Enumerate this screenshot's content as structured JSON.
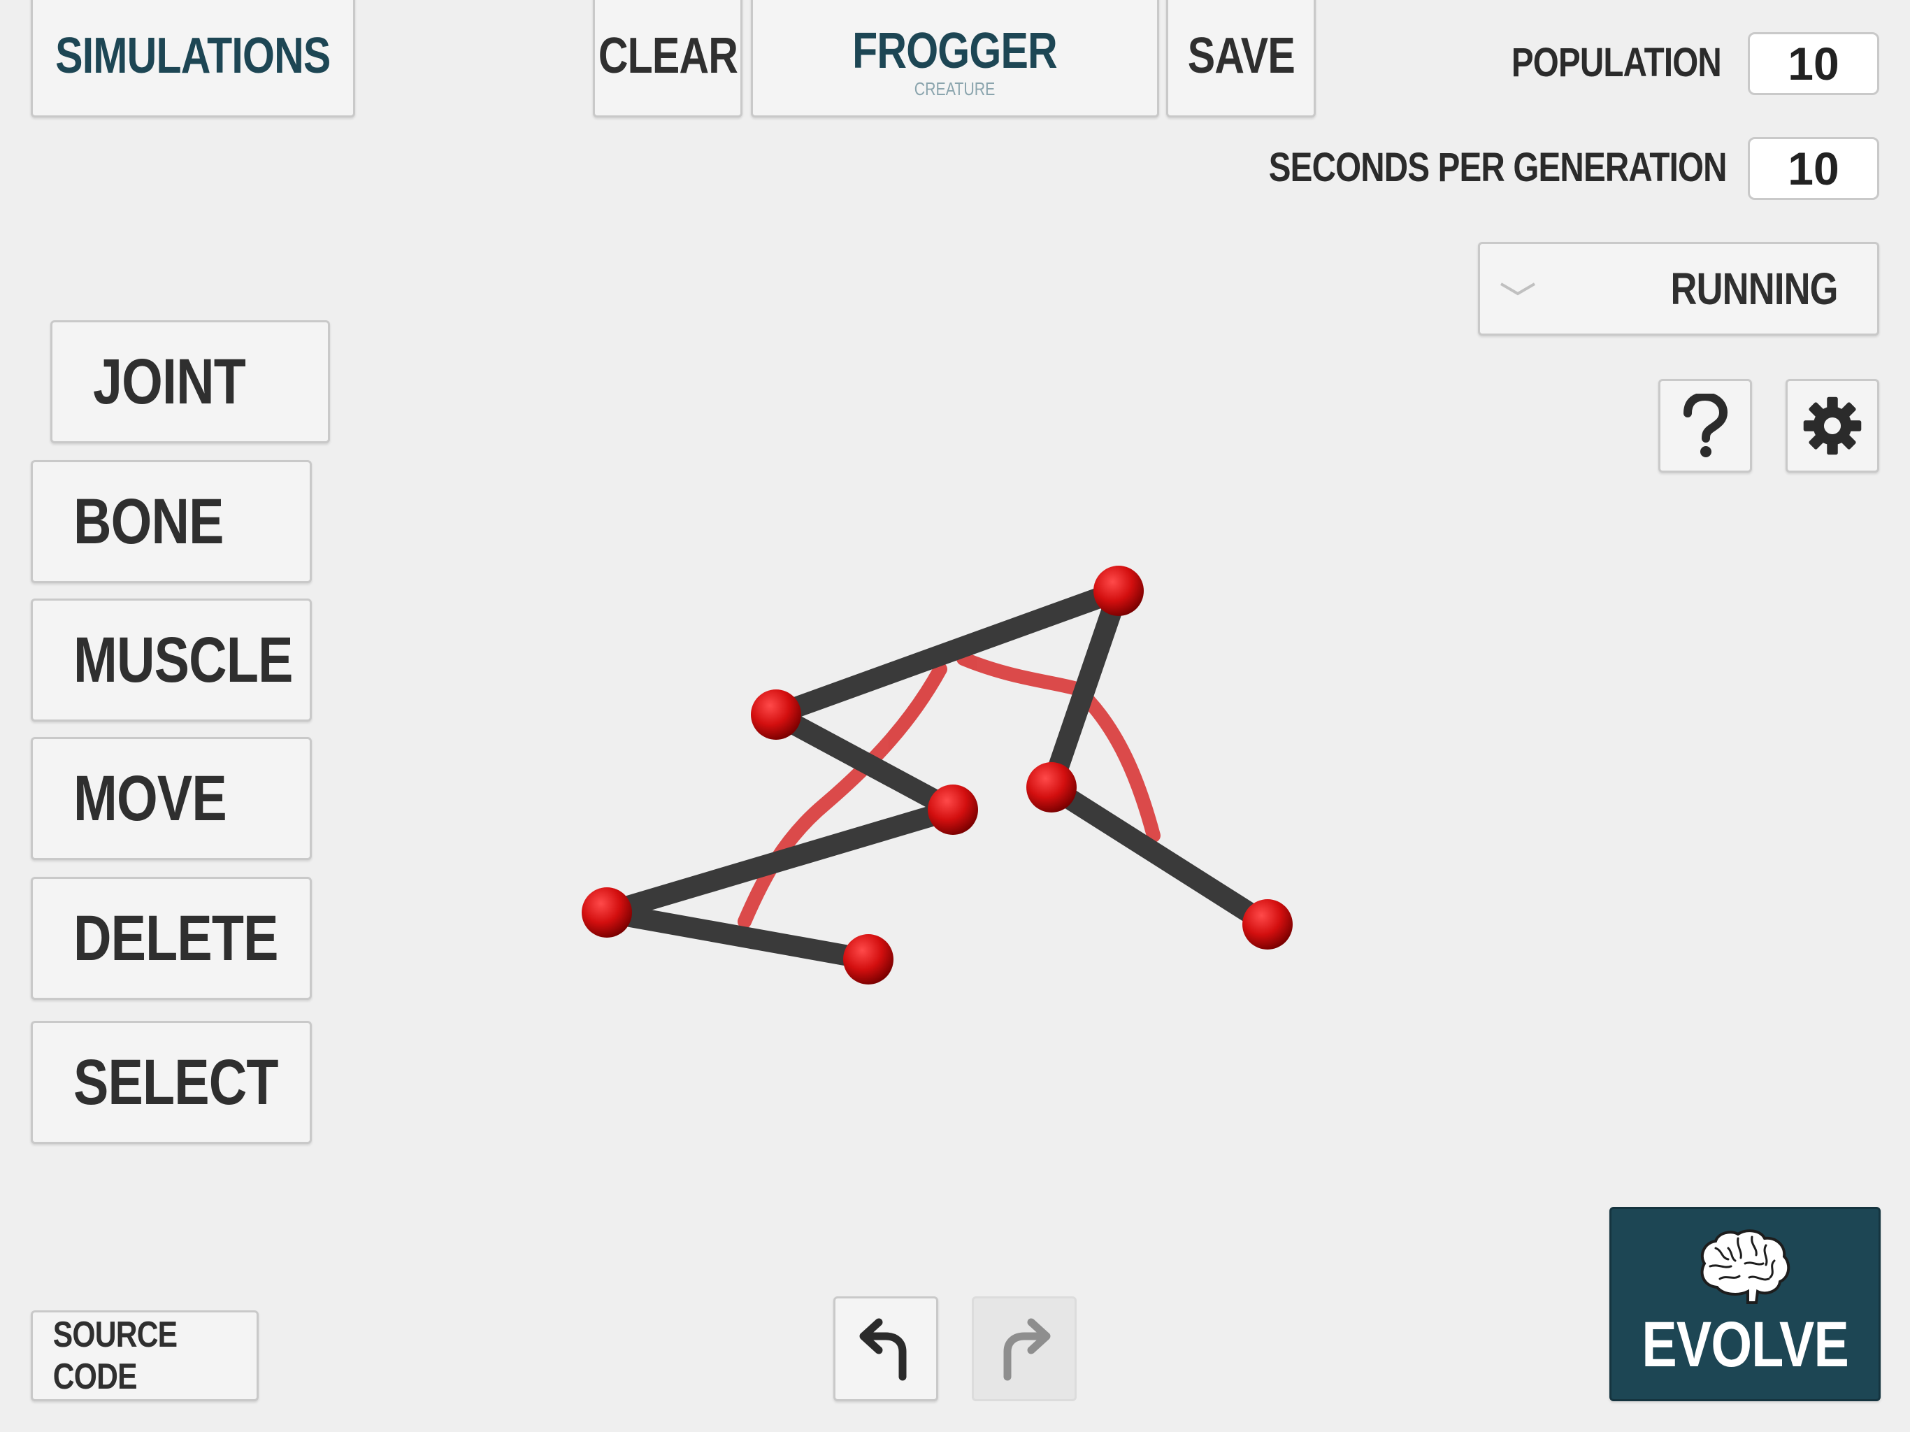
{
  "header": {
    "simulations_label": "SIMULATIONS",
    "clear_label": "CLEAR",
    "creature_name": "FROGGER",
    "creature_caption": "CREATURE",
    "save_label": "SAVE"
  },
  "settings": {
    "population_label": "POPULATION",
    "population_value": "10",
    "seconds_label": "SECONDS PER GENERATION",
    "seconds_value": "10",
    "mode_selected": "RUNNING"
  },
  "tools": {
    "joint": "JOINT",
    "bone": "BONE",
    "muscle": "MUSCLE",
    "move": "MOVE",
    "delete": "DELETE",
    "select": "SELECT"
  },
  "footer": {
    "source_code_label": "SOURCE CODE",
    "evolve_label": "EVOLVE"
  },
  "icons": {
    "help": "question-mark-icon",
    "settings": "gear-icon",
    "undo": "undo-arrow-icon",
    "redo": "redo-arrow-icon",
    "evolve": "brain-icon",
    "dropdown": "chevron-down-icon"
  },
  "colors": {
    "accent": "#1d4654",
    "joint": "#d30f0f",
    "bone": "#3a3a3a",
    "muscle": "#d94040"
  }
}
